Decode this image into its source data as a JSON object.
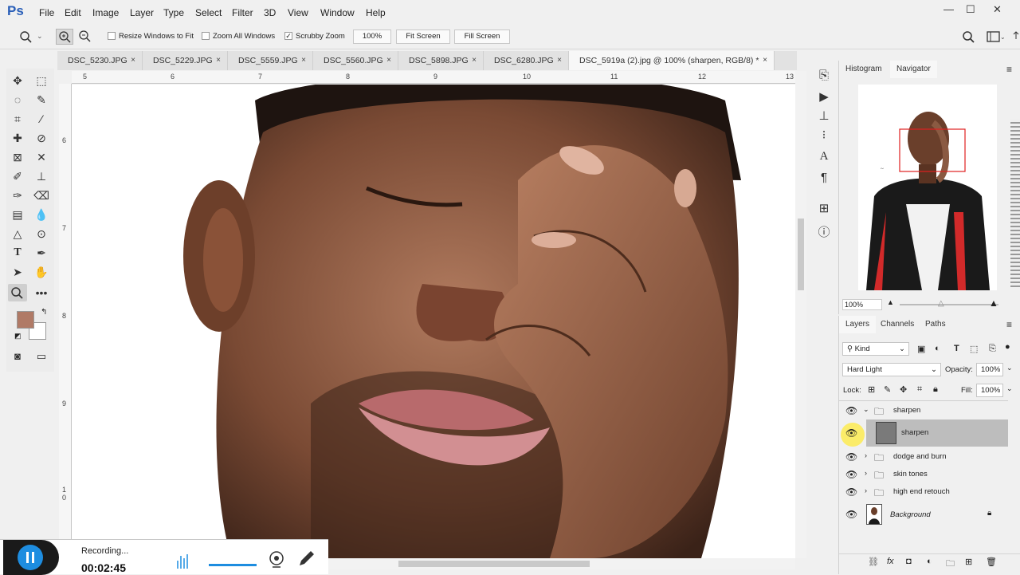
{
  "app": {
    "logo": "Ps"
  },
  "menu": [
    "File",
    "Edit",
    "Image",
    "Layer",
    "Type",
    "Select",
    "Filter",
    "3D",
    "View",
    "Window",
    "Help"
  ],
  "window_controls": {
    "minimize": "—",
    "restore": "☐",
    "close": "✕"
  },
  "options": {
    "resize_windows": "Resize Windows to Fit",
    "zoom_all": "Zoom All Windows",
    "scrubby": "Scrubby Zoom",
    "zoom_value": "100%",
    "fit_screen": "Fit Screen",
    "fill_screen": "Fill Screen"
  },
  "tabs": [
    {
      "label": "DSC_5230.JPG",
      "close": "×"
    },
    {
      "label": "DSC_5229.JPG",
      "close": "×"
    },
    {
      "label": "DSC_5559.JPG",
      "close": "×"
    },
    {
      "label": "DSC_5560.JPG",
      "close": "×"
    },
    {
      "label": "DSC_5898.JPG",
      "close": "×"
    },
    {
      "label": "DSC_6280.JPG",
      "close": "×"
    },
    {
      "label": "DSC_5919a (2).jpg @ 100% (sharpen, RGB/8) *",
      "close": "×"
    }
  ],
  "ruler_top": [
    "5",
    "6",
    "7",
    "8",
    "9",
    "10",
    "11",
    "12",
    "13"
  ],
  "ruler_left": [
    "6",
    "7",
    "8",
    "9",
    "1",
    "0"
  ],
  "navigator": {
    "tabs": [
      "Histogram",
      "Navigator"
    ],
    "zoom": "100%"
  },
  "layers_panel": {
    "tabs": [
      "Layers",
      "Channels",
      "Paths"
    ],
    "kind": "Kind",
    "blend_mode": "Hard Light",
    "opacity_label": "Opacity:",
    "opacity": "100%",
    "lock_label": "Lock:",
    "fill_label": "Fill:",
    "fill": "100%",
    "layers": [
      {
        "name": "sharpen",
        "type": "group-open"
      },
      {
        "name": "sharpen",
        "type": "layer-selected"
      },
      {
        "name": "dodge and burn",
        "type": "group"
      },
      {
        "name": "skin tones",
        "type": "group"
      },
      {
        "name": "high end retouch",
        "type": "group"
      },
      {
        "name": "Background",
        "type": "background"
      }
    ]
  },
  "recorder": {
    "status": "Recording...",
    "time": "00:02:45"
  },
  "colors": {
    "foreground": "#b07a66",
    "background": "#ffffff",
    "accent": "#1e8de0"
  }
}
